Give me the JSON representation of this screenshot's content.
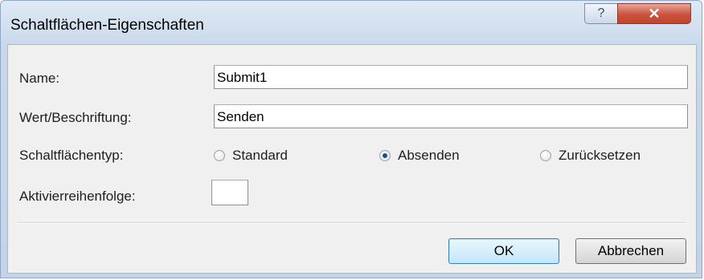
{
  "window": {
    "title": "Schaltflächen-Eigenschaften",
    "help_glyph": "?",
    "close_glyph": "✕"
  },
  "form": {
    "name_label": "Name:",
    "name_value": "Submit1",
    "caption_label": "Wert/Beschriftung:",
    "caption_value": "Senden",
    "type_label": "Schaltflächentyp:",
    "type_options": [
      {
        "label": "Standard",
        "checked": false
      },
      {
        "label": "Absenden",
        "checked": true
      },
      {
        "label": "Zurücksetzen",
        "checked": false
      }
    ],
    "tab_order_label": "Aktivierreihenfolge:",
    "tab_order_value": ""
  },
  "buttons": {
    "ok_label": "OK",
    "cancel_label": "Abbrechen"
  },
  "colors": {
    "close_button": "#c9523d",
    "radio_selected": "#1a4f8a"
  }
}
